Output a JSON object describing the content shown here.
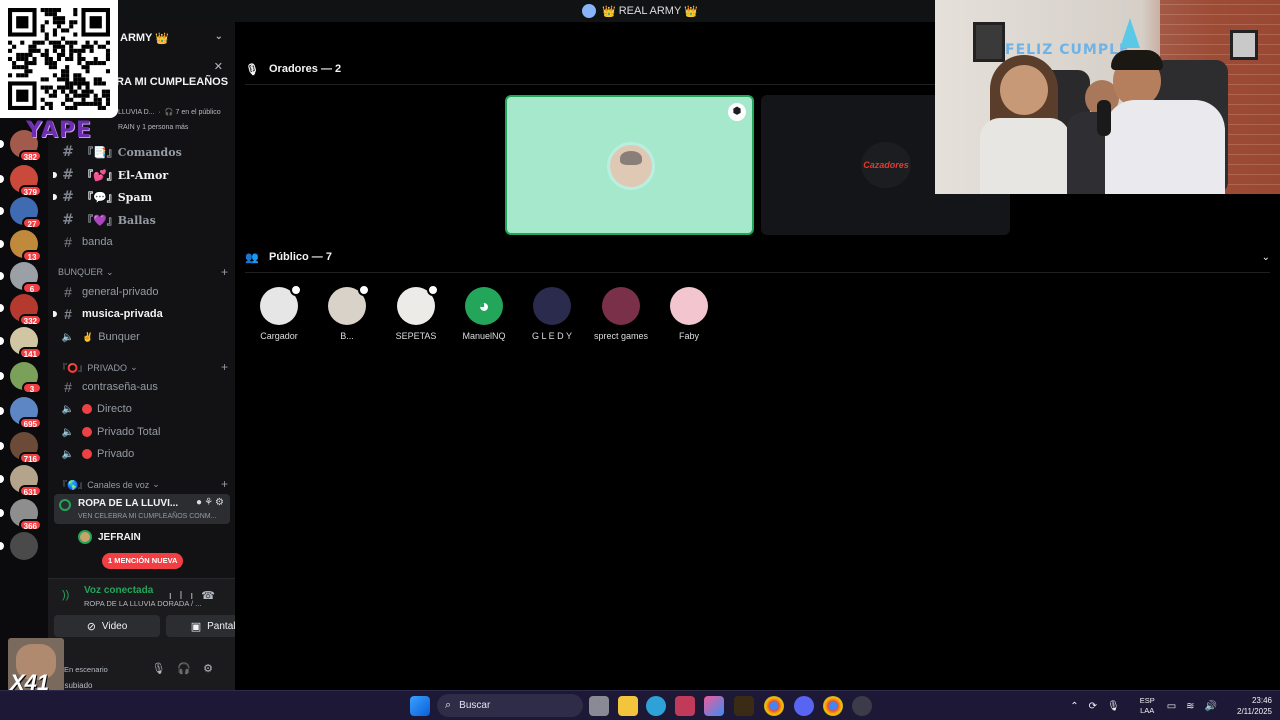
{
  "window": {
    "title": "REAL ARMY",
    "crown": "👑"
  },
  "server": {
    "name": "ARMY",
    "crown": "👑"
  },
  "event": {
    "title": "RA MI CUMPLEAÑOS",
    "meta": "LLUVIA D...",
    "audience": "7 en el público",
    "meta2": "RAIN y 1 persona más"
  },
  "overlay": {
    "yape": "YAPE",
    "facecam_label": "X41"
  },
  "rail": {
    "badges": [
      "382",
      "379",
      "27",
      "13",
      "6",
      "332",
      "141",
      "3",
      "695",
      "716",
      "631",
      "366"
    ]
  },
  "channels": {
    "top": [
      {
        "label": "『📑』Comandos",
        "bold": false
      },
      {
        "label": "『💕』El-Amor",
        "bold": true
      },
      {
        "label": "『💬』Spam",
        "bold": true
      },
      {
        "label": "『💜』Ballas",
        "bold": false
      },
      {
        "label": "banda",
        "bold": false
      }
    ],
    "bunquer_category": "BUNQUER",
    "bunquer": [
      {
        "label": "general-privado",
        "type": "text",
        "bold": false
      },
      {
        "label": "musica-privada",
        "type": "text",
        "bold": true
      },
      {
        "label": "Bunquer",
        "type": "voice",
        "bold": false,
        "emoji": "✌️"
      }
    ],
    "privado_category": "『⭕』PRIVADO",
    "privado": [
      {
        "label": "contraseña-aus",
        "type": "text"
      },
      {
        "label": "Directo",
        "type": "voice",
        "dot": "#ed4245"
      },
      {
        "label": "Privado Total",
        "type": "voice",
        "dot": "#ed4245"
      },
      {
        "label": "Privado",
        "type": "voice",
        "dot": "#ed4245"
      }
    ],
    "voice_category": "『🌎』Canales de voz",
    "active_voice": {
      "name": "ROPA DE LA LLUVI...",
      "subtitle": "VEN CELEBRA MI CUMPLEAÑOS CONM..."
    },
    "member": "JEFRAIN",
    "mention": "1 MENCIÓN NUEVA"
  },
  "voice_panel": {
    "status": "Voz conectada",
    "location": "ROPA DE LA LLUVIA DORADA / ...",
    "video_label": "Video",
    "screen_label": "Pantalla",
    "user_status": "En escenario",
    "deafened": "nsubiado"
  },
  "stage": {
    "speakers_header": "Oradores — 2",
    "audience_header": "Público — 7",
    "speaker2_art": "Cazadores",
    "audience": [
      {
        "name": "Cargador",
        "color": "#e6e6e6",
        "hand": true
      },
      {
        "name": "B...",
        "color": "#d9d2c8",
        "hand": true
      },
      {
        "name": "SEPETAS",
        "color": "#ecebe8",
        "hand": true
      },
      {
        "name": "ManuelNQ",
        "color": "#23a55a",
        "hand": false
      },
      {
        "name": "G L E D Y",
        "color": "#2a2b4d",
        "hand": false
      },
      {
        "name": "sprect games",
        "color": "#7a3048",
        "hand": false
      },
      {
        "name": "Faby",
        "color": "#f3c6cf",
        "hand": false
      }
    ]
  },
  "taskbar": {
    "search": "Buscar",
    "lang1": "ESP",
    "lang2": "LAA",
    "time": "23:46",
    "date": "2/11/2025"
  }
}
